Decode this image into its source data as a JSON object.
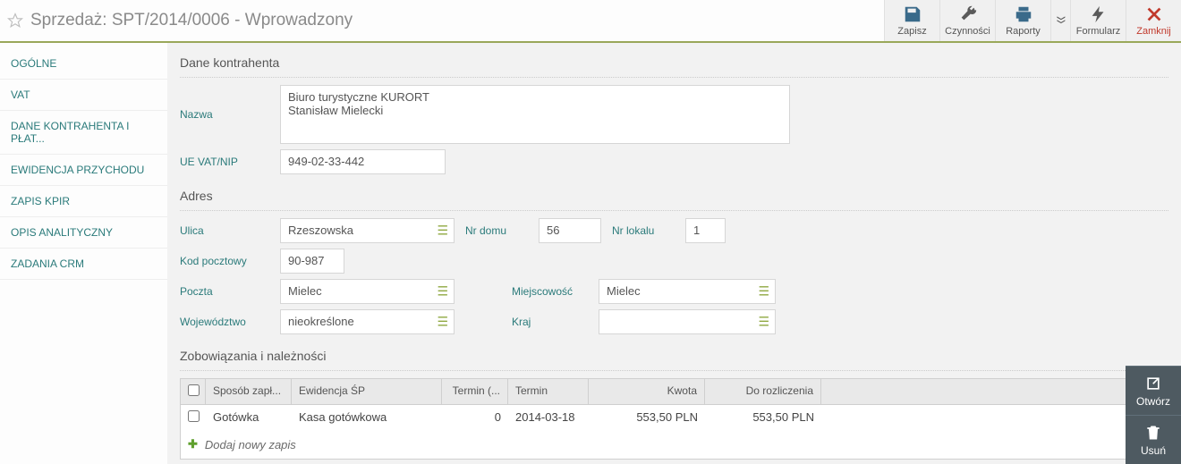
{
  "header": {
    "title": "Sprzedaż: SPT/2014/0006 - Wprowadzony",
    "toolbar": {
      "save": "Zapisz",
      "actions": "Czynności",
      "reports": "Raporty",
      "form": "Formularz",
      "close": "Zamknij"
    }
  },
  "sidebar": {
    "items": [
      "Ogólne",
      "VAT",
      "Dane kontrahenta i płat...",
      "Ewidencja przychodu",
      "Zapis KPiR",
      "Opis analityczny",
      "Zadania CRM"
    ]
  },
  "main": {
    "contractor_section": "Dane kontrahenta",
    "name_label": "Nazwa",
    "name_value": "Biuro turystyczne KURORT\nStanisław Mielecki",
    "vat_label": "UE VAT/NIP",
    "vat_value": "949-02-33-442",
    "address_section": "Adres",
    "addr": {
      "street_label": "Ulica",
      "street": "Rzeszowska",
      "houseno_label": "Nr domu",
      "houseno": "56",
      "flatno_label": "Nr lokalu",
      "flatno": "1",
      "zip_label": "Kod pocztowy",
      "zip": "90-987",
      "post_label": "Poczta",
      "post": "Mielec",
      "city_label": "Miejscowość",
      "city": "Mielec",
      "province_label": "Województwo",
      "province": "nieokreślone",
      "country_label": "Kraj",
      "country": ""
    },
    "obligations_section": "Zobowiązania i należności",
    "grid": {
      "headers": {
        "method": "Sposób zapł...",
        "ledger": "Ewidencja ŚP",
        "term_short": "Termin (...",
        "term": "Termin",
        "amount": "Kwota",
        "to_settle": "Do rozliczenia"
      },
      "row": {
        "method": "Gotówka",
        "ledger": "Kasa gotówkowa",
        "term_short": "0",
        "term": "2014-03-18",
        "amount": "553,50 PLN",
        "to_settle": "553,50 PLN"
      },
      "addrow": "Dodaj nowy zapis"
    },
    "right_actions": {
      "open": "Otwórz",
      "delete": "Usuń"
    }
  }
}
